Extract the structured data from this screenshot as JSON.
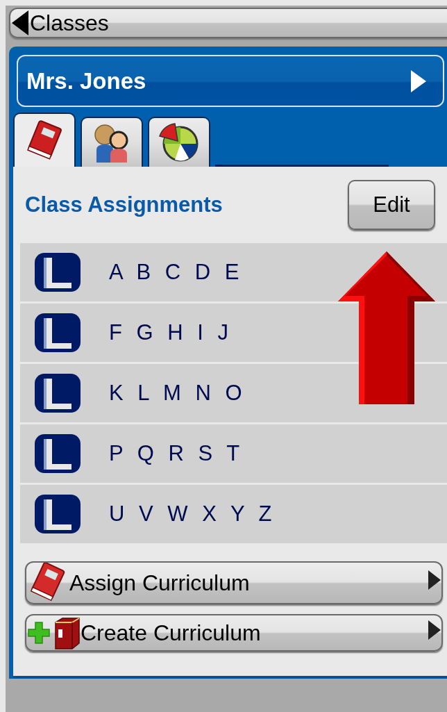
{
  "header": {
    "title": "Classes"
  },
  "class_bar": {
    "title": "Mrs. Jones"
  },
  "tabs": [
    {
      "kind": "book",
      "selected": true
    },
    {
      "kind": "people",
      "selected": false
    },
    {
      "kind": "chart",
      "selected": false
    }
  ],
  "section": {
    "title": "Class Assignments",
    "edit_button": "Edit"
  },
  "assignments": [
    {
      "label": "A B C D E"
    },
    {
      "label": "F G H I J"
    },
    {
      "label": "K L M N O"
    },
    {
      "label": "P Q R S T"
    },
    {
      "label": "U V W X Y Z"
    }
  ],
  "actions": [
    {
      "kind": "assign",
      "label": "Assign Curriculum"
    },
    {
      "kind": "create",
      "label": "Create Curriculum"
    }
  ],
  "annotation": {
    "kind": "arrow"
  }
}
